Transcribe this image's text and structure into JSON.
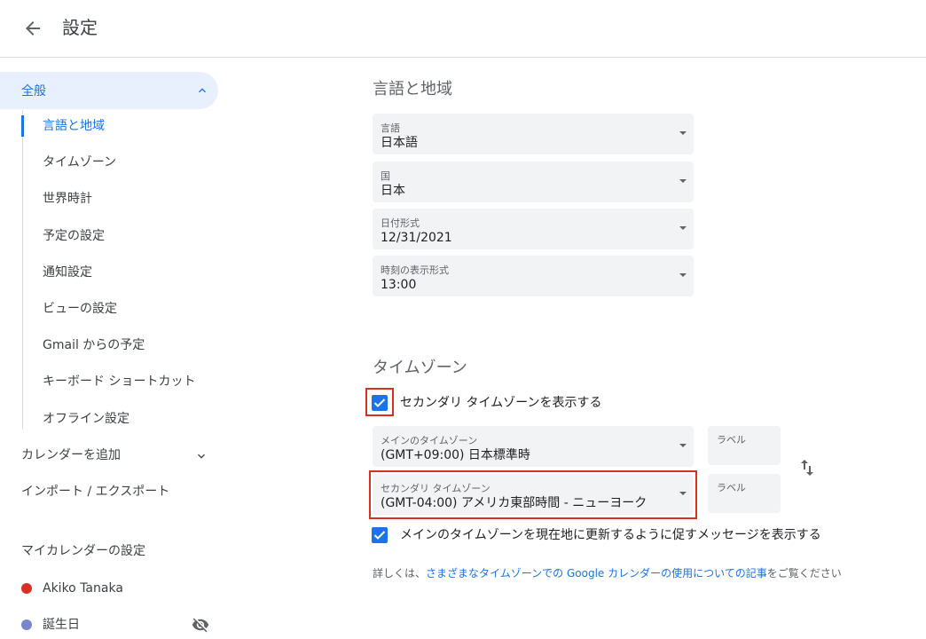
{
  "header": {
    "title": "設定"
  },
  "sidebar": {
    "general": "全般",
    "subitems": [
      "言語と地域",
      "タイムゾーン",
      "世界時計",
      "予定の設定",
      "通知設定",
      "ビューの設定",
      "Gmail からの予定",
      "キーボード ショートカット",
      "オフライン設定"
    ],
    "add_calendar": "カレンダーを追加",
    "import_export": "インポート / エクスポート",
    "my_calendars_heading": "マイカレンダーの設定",
    "calendars": [
      {
        "name": "Akiko Tanaka",
        "color": "#d93025"
      },
      {
        "name": "誕生日",
        "color": "#7986cb"
      }
    ]
  },
  "language_region": {
    "title": "言語と地域",
    "fields": [
      {
        "label": "言語",
        "value": "日本語"
      },
      {
        "label": "国",
        "value": "日本"
      },
      {
        "label": "日付形式",
        "value": "12/31/2021"
      },
      {
        "label": "時刻の表示形式",
        "value": "13:00"
      }
    ]
  },
  "timezone": {
    "title": "タイムゾーン",
    "show_secondary_label": "セカンダリ タイムゾーンを表示する",
    "show_secondary_checked": true,
    "primary": {
      "label": "メインのタイムゾーン",
      "value": "(GMT+09:00) 日本標準時",
      "tag_placeholder": "ラベル"
    },
    "secondary": {
      "label": "セカンダリ タイムゾーン",
      "value": "(GMT-04:00) アメリカ東部時間 - ニューヨーク",
      "tag_placeholder": "ラベル"
    },
    "prompt_update_label": "メインのタイムゾーンを現在地に更新するように促すメッセージを表示する",
    "prompt_update_checked": true,
    "info_prefix": "詳しくは、",
    "info_link": "さまざまなタイムゾーンでの Google カレンダーの使用についての記事",
    "info_suffix": "をご覧ください"
  },
  "colors": {
    "accent": "#1a73e8",
    "highlight": "#d93025",
    "field_bg": "#f1f3f4"
  }
}
